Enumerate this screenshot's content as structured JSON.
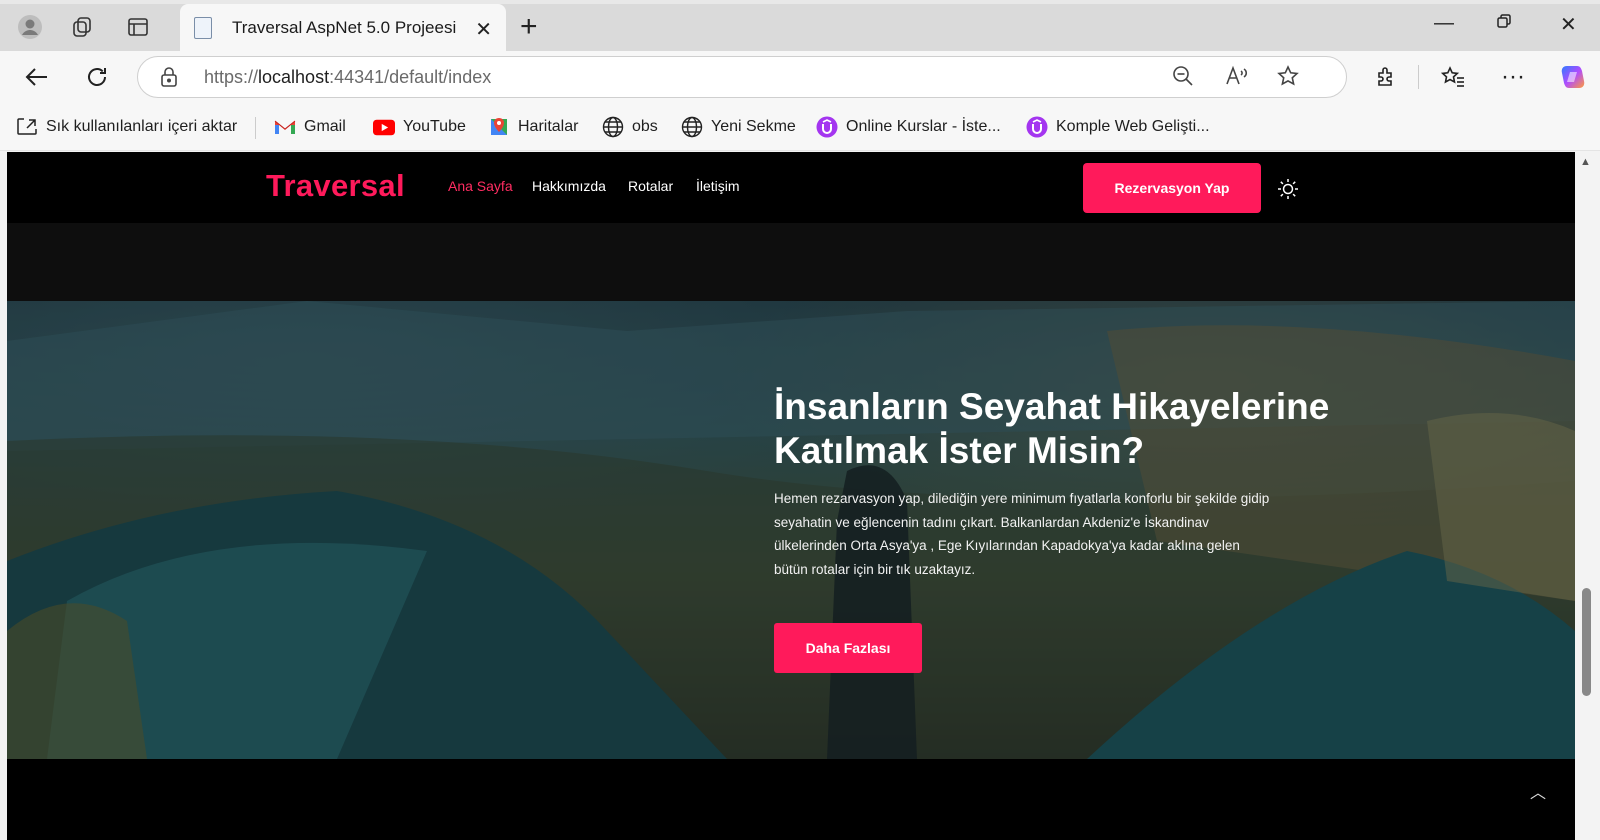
{
  "browser": {
    "tab_title": "Traversal AspNet 5.0 Projeesi",
    "url_prefix": "https://",
    "url_host": "localhost",
    "url_rest": ":44341/default/index"
  },
  "bookmarks": [
    {
      "label": "Sık kullanılanları içeri aktar",
      "icon": "import-icon"
    },
    {
      "label": "Gmail",
      "icon": "gmail-icon"
    },
    {
      "label": "YouTube",
      "icon": "youtube-icon"
    },
    {
      "label": "Haritalar",
      "icon": "maps-icon"
    },
    {
      "label": "obs",
      "icon": "globe-icon"
    },
    {
      "label": "Yeni Sekme",
      "icon": "globe-icon"
    },
    {
      "label": "Online Kurslar - İste...",
      "icon": "udemy-icon"
    },
    {
      "label": "Komple Web Gelişti...",
      "icon": "udemy-icon"
    }
  ],
  "site": {
    "logo": "Traversal",
    "menu": [
      "Ana Sayfa",
      "Hakkımızda",
      "Rotalar",
      "İletişim"
    ],
    "cta": "Rezervasyon Yap",
    "hero_title_line1": "İnsanların Seyahat Hikayelerine",
    "hero_title_line2": "Katılmak İster Misin?",
    "hero_text": "Hemen rezarvasyon yap, dilediğin yere minimum fıyatlarla konforlu bir şekilde gidip seyahatin ve eğlencenin tadını çıkart. Balkanlardan Akdeniz'e İskandinav ülkelerinden Orta Asya'ya , Ege Kıyılarından Kapadokya'ya kadar aklına gelen bütün rotalar için bir tık uzaktayız.",
    "hero_button": "Daha Fazlası"
  },
  "colors": {
    "accent": "#ff1a5b",
    "nav_bg": "#000000"
  }
}
